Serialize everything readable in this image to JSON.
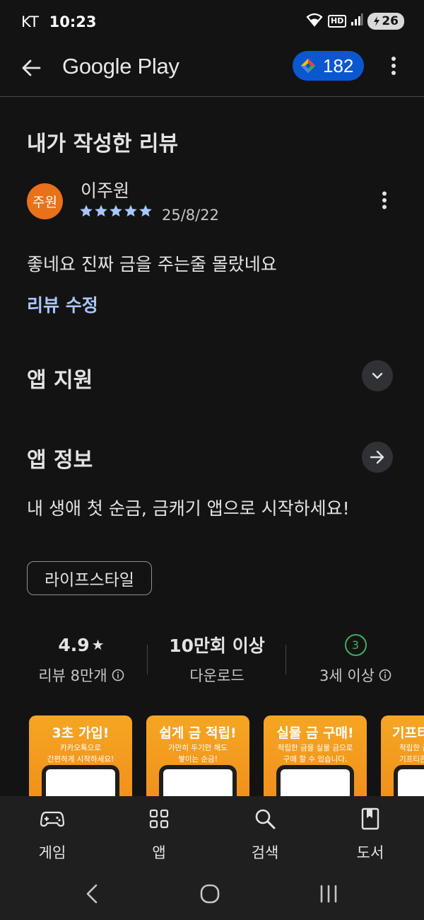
{
  "status_bar": {
    "carrier": "KT",
    "time": "10:23",
    "battery": "26"
  },
  "app_bar": {
    "title": "Google Play",
    "points": "182"
  },
  "my_review": {
    "section_title": "내가 작성한 리뷰",
    "avatar_text": "주원",
    "reviewer_name": "이주원",
    "rating": 5,
    "date": "25/8/22",
    "text": "좋네요 진짜 금을 주는줄 몰랐네요",
    "edit_label": "리뷰 수정"
  },
  "app_support": {
    "title": "앱 지원"
  },
  "app_info": {
    "title": "앱 정보",
    "description": "내 생애 첫 순금, 금캐기 앱으로 시작하세요!",
    "category_chip": "라이프스타일"
  },
  "stats": {
    "rating": "4.9",
    "rating_star": "★",
    "reviews_label": "리뷰 8만개",
    "downloads": "10만회 이상",
    "downloads_label": "다운로드",
    "age_badge": "3",
    "age_label": "3세 이상"
  },
  "screenshots": [
    {
      "title": "3초 가입!",
      "subtitle": "카카오톡으로\n간편하게 시작하세요!"
    },
    {
      "title": "쉽게 금 적립!",
      "subtitle": "가만히 두기만 해도\n쌓이는 순금!"
    },
    {
      "title": "실물 금 구매!",
      "subtitle": "적립한 금을 실물 금으로\n구매 할 수 있습니다."
    },
    {
      "title": "기프티",
      "subtitle": "적립한 금\n기프티콘"
    }
  ],
  "bottom_nav": {
    "items": [
      {
        "label": "게임",
        "icon": "gamepad-icon"
      },
      {
        "label": "앱",
        "icon": "apps-grid-icon"
      },
      {
        "label": "검색",
        "icon": "search-icon"
      },
      {
        "label": "도서",
        "icon": "book-icon"
      }
    ]
  },
  "colors": {
    "background": "#131314",
    "accent_link": "#a8c7fa",
    "points_pill": "#0b57d0",
    "avatar": "#e8711a",
    "star": "#a8c7fa",
    "age_badge": "#3dae5a"
  }
}
